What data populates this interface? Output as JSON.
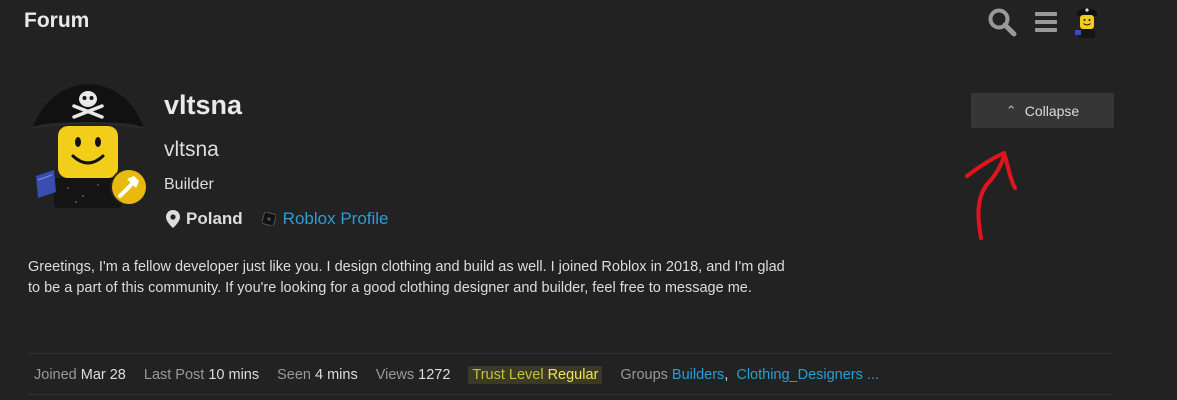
{
  "header": {
    "title": "Forum",
    "search_icon": "search-icon",
    "menu_icon": "hamburger-menu-icon",
    "avatar_icon": "user-avatar-icon"
  },
  "profile": {
    "username": "vltsna",
    "name": "vltsna",
    "title": "Builder",
    "location": "Poland",
    "profile_link": "Roblox Profile",
    "collapse_label": "Collapse",
    "bio": "Greetings, I'm a fellow developer just like you. I design clothing and build as well. I joined Roblox in 2018, and I'm glad to be a part of this community. If you're looking for a good clothing designer and builder, feel free to message me."
  },
  "stats": {
    "joined_label": "Joined",
    "joined_value": "Mar 28",
    "last_post_label": "Last Post",
    "last_post_value": "10 mins",
    "seen_label": "Seen",
    "seen_value": "4 mins",
    "views_label": "Views",
    "views_value": "1272",
    "trust_label": "Trust Level",
    "trust_value": "Regular",
    "groups_label": "Groups",
    "groups": [
      "Builders",
      "Clothing_Designers"
    ],
    "groups_more": "..."
  },
  "colors": {
    "background": "#222222",
    "link": "#2a9dd8",
    "trust_highlight": "#efe45a",
    "annotation": "#e0141c"
  }
}
